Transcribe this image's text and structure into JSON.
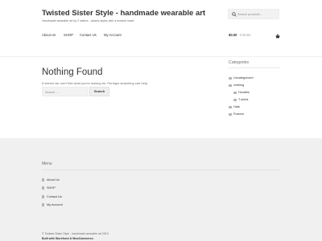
{
  "header": {
    "site_title": "Twisted Sister Style - handmade wearable art",
    "site_description": "Handmade wearable art by 2 sisters - classic styles with a modern twist!",
    "search": {
      "placeholder": "Search products…"
    }
  },
  "nav": {
    "items": [
      {
        "label": "About Us"
      },
      {
        "label": "SHOP"
      },
      {
        "label": "Contact Us"
      },
      {
        "label": "My Account"
      }
    ],
    "cart": {
      "amount": "$0.00",
      "count": "0 items"
    }
  },
  "main": {
    "title": "Nothing Found",
    "message": "It seems we can't find what you're looking for. Perhaps searching can help.",
    "search": {
      "placeholder": "Search …",
      "button_label": "Search"
    }
  },
  "sidebar": {
    "widget_title": "Categories",
    "categories": [
      {
        "label": "Uncategorized"
      },
      {
        "label": "clothing"
      },
      {
        "label": "Hoodies"
      },
      {
        "label": "T-shirts"
      },
      {
        "label": "Hats"
      },
      {
        "label": "Posters"
      }
    ]
  },
  "footer": {
    "menu_title": "Menu",
    "menu_items": [
      {
        "label": "About Us"
      },
      {
        "label": "SHOP"
      },
      {
        "label": "Contact Us"
      },
      {
        "label": "My Account"
      }
    ],
    "copyright": "© Twisted Sister Style - handmade wearable art 2019",
    "built_with": "Built with Storefront & WooCommerce."
  }
}
